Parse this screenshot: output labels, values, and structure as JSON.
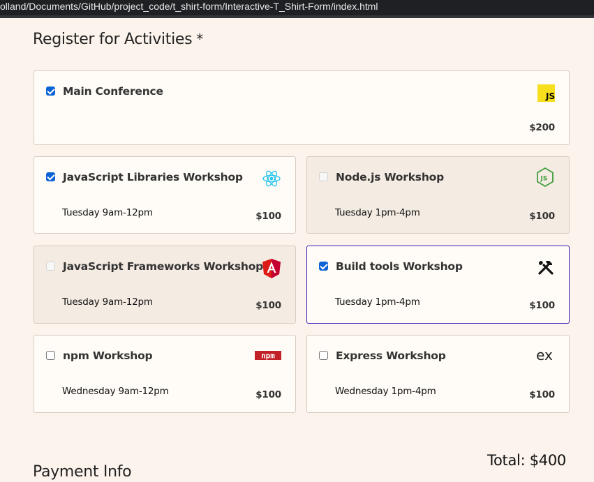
{
  "browser": {
    "url": "olland/Documents/GitHub/project_code/t_shirt-form/Interactive-T_Shirt-Form/index.html"
  },
  "activities": {
    "title": "Register for Activities",
    "required_marker": "*",
    "items": [
      {
        "name": "Main Conference",
        "time": "",
        "price": "$200",
        "checked": true,
        "disabled": false,
        "icon": "javascript-logo-icon",
        "icon_text": "JS"
      },
      {
        "name": "JavaScript Libraries Workshop",
        "time": "Tuesday 9am-12pm",
        "price": "$100",
        "checked": true,
        "disabled": false,
        "icon": "react-logo-icon"
      },
      {
        "name": "Node.js Workshop",
        "time": "Tuesday 1pm-4pm",
        "price": "$100",
        "checked": false,
        "disabled": true,
        "icon": "nodejs-logo-icon"
      },
      {
        "name": "JavaScript Frameworks Workshop",
        "time": "Tuesday 9am-12pm",
        "price": "$100",
        "checked": false,
        "disabled": true,
        "icon": "angular-logo-icon"
      },
      {
        "name": "Build tools Workshop",
        "time": "Tuesday 1pm-4pm",
        "price": "$100",
        "checked": true,
        "disabled": false,
        "focused": true,
        "icon": "build-tools-icon"
      },
      {
        "name": "npm Workshop",
        "time": "Wednesday 9am-12pm",
        "price": "$100",
        "checked": false,
        "disabled": false,
        "icon": "npm-logo-icon",
        "icon_text": "npm"
      },
      {
        "name": "Express Workshop",
        "time": "Wednesday 1pm-4pm",
        "price": "$100",
        "checked": false,
        "disabled": false,
        "icon": "express-logo-icon",
        "icon_text": "ex"
      }
    ],
    "total_text": "Total: $400"
  },
  "payment": {
    "title": "Payment Info"
  },
  "colors": {
    "page_bg": "#fcf4ec",
    "card_bg": "#fffcf7",
    "disabled_card_bg": "#f4ebe3",
    "focus_border": "#3b18b8",
    "checkbox_checked": "#0b63d6",
    "js_yellow": "#f7df1e",
    "react_cyan": "#29c5f0",
    "node_green": "#3f9d3c",
    "angular_red": "#dd1b16",
    "npm_red": "#c12127"
  }
}
